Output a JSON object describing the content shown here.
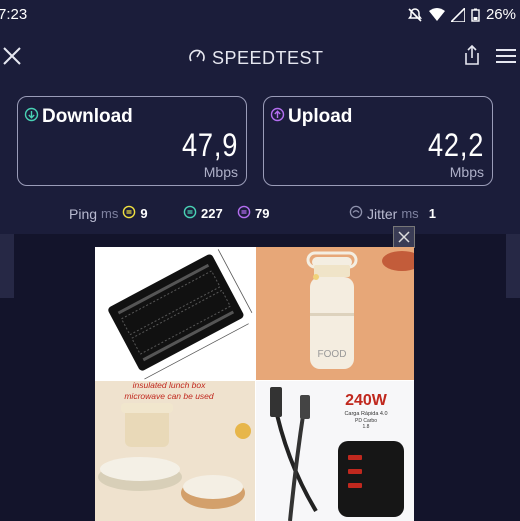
{
  "status_bar": {
    "time": "7:23",
    "battery": "26%",
    "icons": [
      "mute-icon",
      "wifi-icon",
      "signal-icon",
      "battery-icon"
    ]
  },
  "header": {
    "title": "SPEEDTEST",
    "close_icon": "close-icon",
    "share_icon": "share-icon",
    "menu_icon": "menu-icon"
  },
  "download": {
    "label": "Download",
    "value": "47,9",
    "unit": "Mbps",
    "icon": "arrow-down-circle-icon",
    "accent": "#49d2b5"
  },
  "upload": {
    "label": "Upload",
    "value": "42,2",
    "unit": "Mbps",
    "icon": "arrow-up-circle-icon",
    "accent": "#b46ef0"
  },
  "ping": {
    "label": "Ping",
    "unit": "ms",
    "idle": "9",
    "download": "227",
    "upload": "79"
  },
  "jitter": {
    "label": "Jitter",
    "unit": "ms",
    "value": "1"
  },
  "ad": {
    "close_icon": "close-icon",
    "tile_3_text_line1": "insulated lunch box",
    "tile_3_text_line2": "microwave can be used",
    "tile_4_wattage": "240W",
    "tile_4_subtext_line1": "Carga Rápida 4.0",
    "tile_4_subtext_line2": "PD Carbo",
    "tile_4_subtext_line3": "1.8",
    "tile_2_brand": "FOOD"
  },
  "colors": {
    "background": "#1b1d3a",
    "download_accent": "#49d2b5",
    "upload_accent": "#b46ef0",
    "ping_idle": "#f0e040",
    "card_border": "#9a9cb8"
  }
}
